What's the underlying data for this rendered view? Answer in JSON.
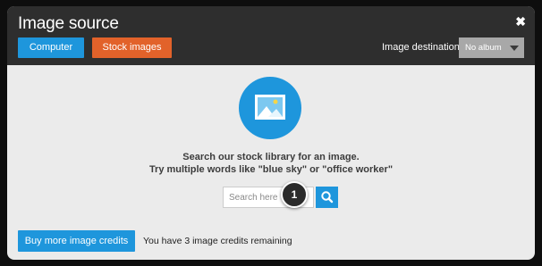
{
  "dialog": {
    "title": "Image source",
    "close_glyph": "✖"
  },
  "toolbar": {
    "computer_label": "Computer",
    "stock_label": "Stock images",
    "destination_label": "Image destination",
    "album_selected": "No album"
  },
  "main": {
    "message_line1": "Search our stock library for an image.",
    "message_line2": "Try multiple words like \"blue sky\" or \"office worker\"",
    "search_placeholder": "Search here",
    "search_value": "",
    "step_badge": "1"
  },
  "footer": {
    "buy_credits_label": "Buy more image credits",
    "credits_text": "You have 3 image credits remaining"
  },
  "colors": {
    "accent_blue": "#1e96dc",
    "accent_orange": "#e2622a",
    "header_bg": "#2e2e2e",
    "body_bg": "#ebebeb"
  },
  "icons": [
    "close-icon",
    "image-placeholder-icon",
    "search-icon",
    "chevron-down-icon"
  ]
}
